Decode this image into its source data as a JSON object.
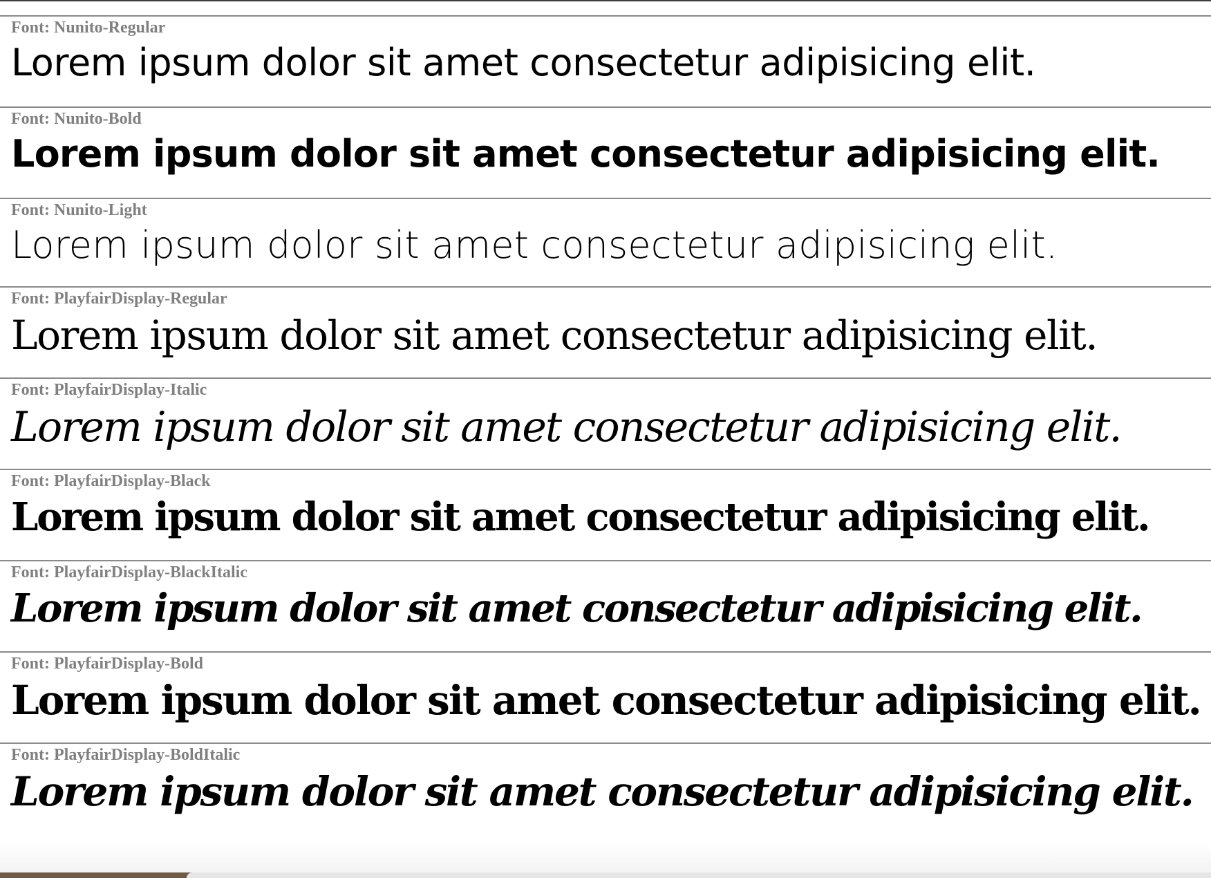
{
  "samples": [
    {
      "label": "Font: Nunito-Regular",
      "text": "Lorem ipsum dolor sit amet consectetur adipisicing elit."
    },
    {
      "label": "Font: Nunito-Bold",
      "text": "Lorem ipsum dolor sit amet consectetur adipisicing elit."
    },
    {
      "label": "Font: Nunito-Light",
      "text": "Lorem ipsum dolor sit amet consectetur adipisicing elit."
    },
    {
      "label": "Font: PlayfairDisplay-Regular",
      "text": "Lorem ipsum dolor sit amet consectetur adipisicing elit."
    },
    {
      "label": "Font: PlayfairDisplay-Italic",
      "text": "Lorem ipsum dolor sit amet consectetur adipisicing elit."
    },
    {
      "label": "Font: PlayfairDisplay-Black",
      "text": "Lorem ipsum dolor sit amet consectetur adipisicing elit."
    },
    {
      "label": "Font: PlayfairDisplay-BlackItalic",
      "text": "Lorem ipsum dolor sit amet consectetur adipisicing elit."
    },
    {
      "label": "Font: PlayfairDisplay-Bold",
      "text": "Lorem ipsum dolor sit amet consectetur adipisicing elit."
    },
    {
      "label": "Font: PlayfairDisplay-BoldItalic",
      "text": "Lorem ipsum dolor sit amet consectetur adipisicing elit."
    }
  ],
  "colors": {
    "label": "#808080",
    "sample_text": "#000000",
    "divider": "#8a8a8a",
    "background": "#ffffff"
  }
}
